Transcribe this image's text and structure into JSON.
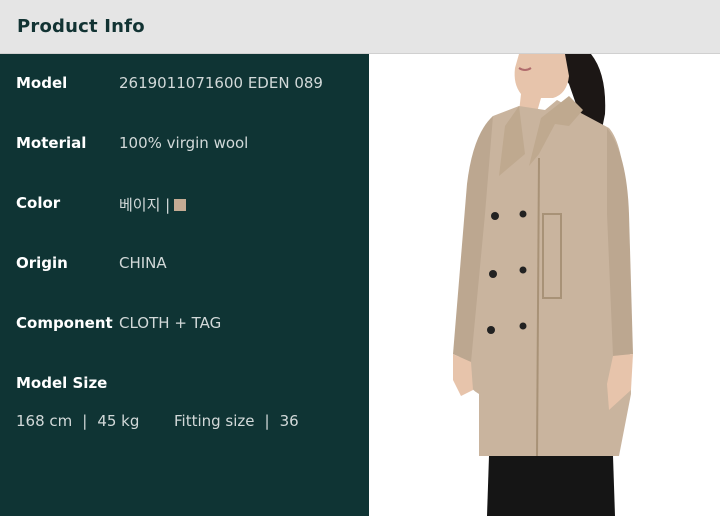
{
  "header": {
    "title": "Product Info"
  },
  "details": {
    "model": {
      "label": "Model",
      "value": "2619011071600 EDEN 089"
    },
    "material": {
      "label": "Moterial",
      "value": "100% virgin wool"
    },
    "color": {
      "label": "Color",
      "value": "베이지 |",
      "swatch": "#c4ab94"
    },
    "origin": {
      "label": "Origin",
      "value": "CHINA"
    },
    "component": {
      "label": "Component",
      "value": "CLOTH + TAG"
    }
  },
  "model_size": {
    "label": "Model Size",
    "height": "168 cm",
    "weight": "45 kg",
    "fitting_label": "Fitting size",
    "fitting_value": "36",
    "separator": "|"
  },
  "colors": {
    "header_bg": "#e5e5e5",
    "panel_bg": "#0f3434",
    "coat": "#c9b49e"
  }
}
